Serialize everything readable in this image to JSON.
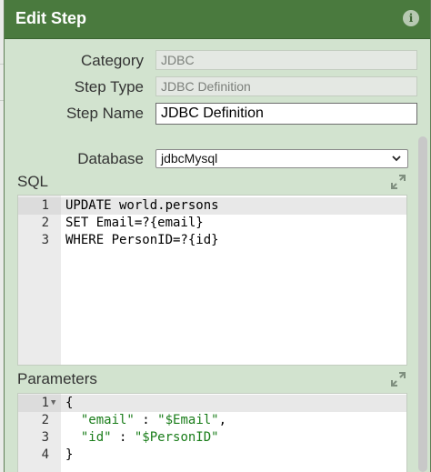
{
  "dialog": {
    "title": "Edit Step",
    "info_icon": "i"
  },
  "form": {
    "category": {
      "label": "Category",
      "value": "JDBC"
    },
    "step_type": {
      "label": "Step Type",
      "value": "JDBC Definition"
    },
    "step_name": {
      "label": "Step Name",
      "value": "JDBC Definition"
    },
    "database": {
      "label": "Database",
      "value": "jdbcMysql"
    }
  },
  "sql": {
    "label": "SQL",
    "lines": [
      {
        "num": "1",
        "text": "UPDATE world.persons"
      },
      {
        "num": "2",
        "text": "SET Email=?{email}"
      },
      {
        "num": "3",
        "text": "WHERE PersonID=?{id}"
      }
    ]
  },
  "parameters": {
    "label": "Parameters",
    "lines": [
      {
        "num": "1",
        "key": "",
        "sep": "",
        "value": "",
        "plain": "{"
      },
      {
        "num": "2",
        "key": "\"email\"",
        "sep": " : ",
        "value": "\"$Email\"",
        "tail": ","
      },
      {
        "num": "3",
        "key": "\"id\"",
        "sep": " : ",
        "value": "\"$PersonID\"",
        "tail": ""
      },
      {
        "num": "4",
        "key": "",
        "sep": "",
        "value": "",
        "plain": "}"
      }
    ]
  },
  "colors": {
    "titlebar": "#4a7a3e",
    "dialog_bg": "#d2e3cf",
    "string": "#1a7d1a"
  },
  "icons": {
    "info": "info-icon",
    "expand_sql": "expand-icon",
    "expand_params": "expand-icon",
    "select_chevron": "chevron-down-icon",
    "fold": "fold-arrow-icon"
  }
}
